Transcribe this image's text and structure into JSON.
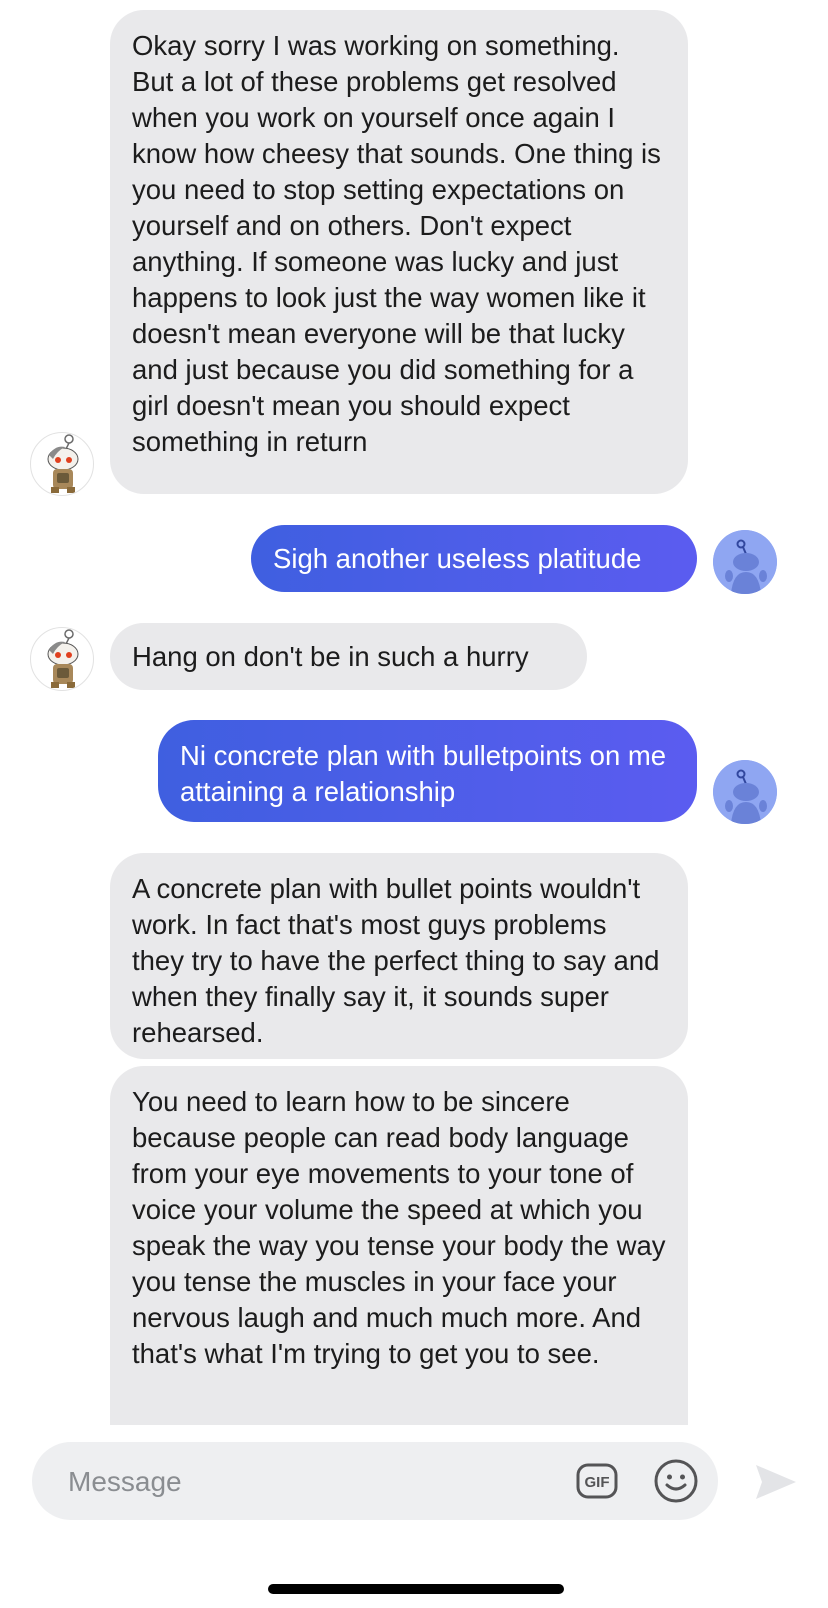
{
  "messages": [
    {
      "from": "other",
      "text": "Okay sorry I was working on something. But a lot of these problems get resolved when you work on yourself once again I know how cheesy that sounds. One thing is you need to stop setting expectations on yourself and on others. Don't expect anything. If someone was lucky and just happens to look just the way women like it doesn't mean everyone will be that lucky and just because you did something for a girl doesn't mean you should expect something in return"
    },
    {
      "from": "me",
      "text": "Sigh another useless platitude"
    },
    {
      "from": "other",
      "text": "Hang on don't be in such a hurry"
    },
    {
      "from": "me",
      "text": "Ni concrete plan with bulletpoints on me attaining a relationship"
    },
    {
      "from": "other",
      "text": "A concrete plan with bullet points wouldn't work. In fact that's most guys problems they try to have the perfect thing to say and when they finally say it, it sounds super rehearsed."
    },
    {
      "from": "other",
      "text": "You need to learn how to be sincere because people can read body language from your eye movements to your tone of voice your volume the speed at which you speak the way you tense your body the way you tense the muscles in your face your nervous laugh and much much more. And that's what I'm trying to get you to see."
    }
  ],
  "composer": {
    "placeholder": "Message",
    "gif_icon": "gif-icon",
    "emoji_icon": "emoji-icon",
    "send_icon": "send-icon"
  },
  "colors": {
    "incoming_bubble": "#e9e9eb",
    "outgoing_bubble_start": "#3f5fe0",
    "outgoing_bubble_end": "#5b5cf0",
    "composer_bg": "#eeeff1"
  }
}
